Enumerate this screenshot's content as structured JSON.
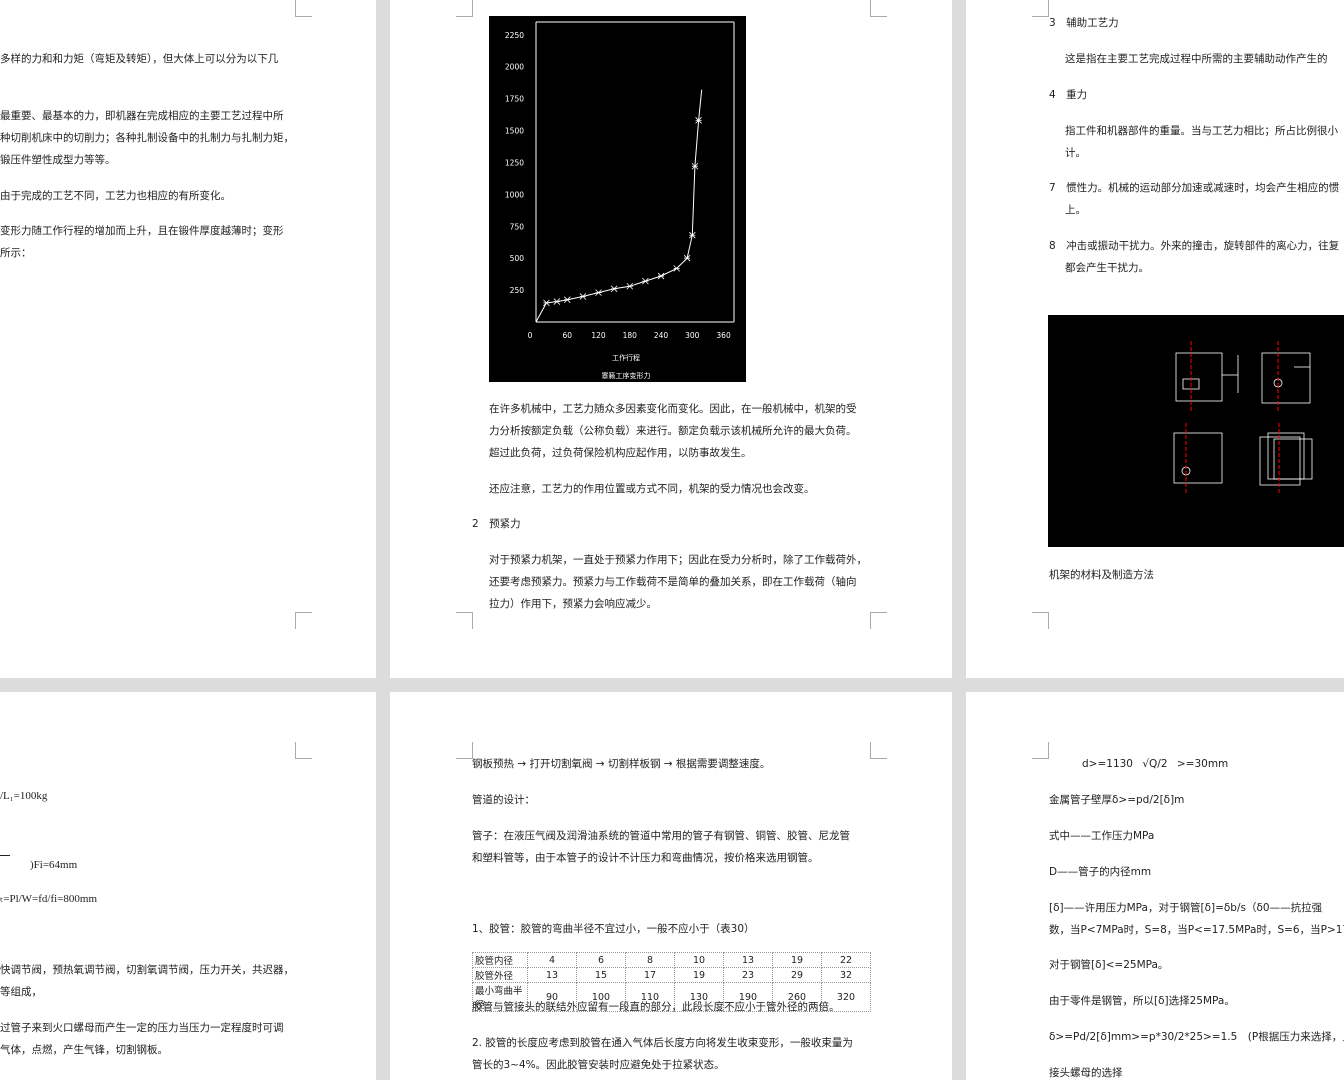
{
  "pages": {
    "p1": {
      "lines": [
        "多样的力和和力矩（弯矩及转矩），但大体上可以分为以下几",
        "最重要、最基本的力，即机器在完成相应的主要工艺过程中所",
        "种切削机床中的切削力；各种扎制设备中的扎制力与扎制力矩，",
        "锻压件塑性成型力等等。",
        "由于完成的工艺不同，工艺力也相应的有所变化。",
        "变形力随工作行程的增加而上升，且在锻件厚度越薄时；变形",
        "所示："
      ]
    },
    "p2": {
      "para1": [
        "在许多机械中，工艺力随众多因素变化而变化。因此，在一般机械中，机架的受",
        "力分析按额定负载（公称负载）来进行。额定负载示该机械所允许的最大负荷。",
        "超过此负荷，过负荷保险机构应起作用，以防事故发生。"
      ],
      "para2": "还应注意，工艺力的作用位置或方式不同，机架的受力情况也会改变。",
      "heading": "2　预紧力",
      "para3": [
        "对于预紧力机架，一直处于预紧力作用下；因此在受力分析时，除了工作载荷外，",
        "还要考虑预紧力。预紧力与工作载荷不是简单的叠加关系，即在工作载荷（轴向",
        "拉力）作用下，预紧力会响应减少。"
      ]
    },
    "p3": {
      "h3": "3　辅助工艺力",
      "t3": "这是指在主要工艺完成过程中所需的主要辅助动作产生的",
      "h4": "4　重力",
      "t4a": "指工件和机器部件的重量。当与工艺力相比；所占比例很小",
      "t4b": "计。",
      "h7a": "7　惯性力。机械的运动部分加速或减速时，均会产生相应的惯",
      "h7b": "上。",
      "h8a": "8　冲击或振动干扰力。外来的撞击，旋转部件的离心力，往复",
      "h8b": "都会产生干扰力。",
      "footer": "机架的材料及制造方法"
    },
    "p4": {
      "l1": "/L₁=100kg",
      "l2": ")Fi=64mm",
      "l3": "ₜ=Pl/W=fd/fi=800mm",
      "l4": "快调节阀，预热氧调节阀，切割氧调节阀，压力开关，共迟器，",
      "l5": "等组成，",
      "l6": "过管子来到火口螺母而产生一定的压力当压力一定程度时可调",
      "l7": "气体，点燃，产生气锋，切割钢板。"
    },
    "p5": {
      "flow": "钢板预热 → 打开切割氧阀 → 切割样板钢 → 根据需要调整速度。",
      "design": "管道的设计：",
      "pipe1": "管子：在液压气阀及润滑油系统的管道中常用的管子有钢管、铜管、胶管、尼龙管",
      "pipe2": "和塑料管等，由于本管子的设计不计压力和弯曲情况，按价格来选用钢管。",
      "hose_title": "1、胶管：胶管的弯曲半径不宜过小，一般不应小于（表30）",
      "table": {
        "rows": [
          {
            "label": "胶管内径",
            "values": [
              "4",
              "6",
              "8",
              "10",
              "13",
              "19",
              "22"
            ]
          },
          {
            "label": "胶管外径",
            "values": [
              "13",
              "15",
              "17",
              "19",
              "23",
              "29",
              "32"
            ]
          },
          {
            "label": "最小弯曲半径",
            "values": [
              "90",
              "100",
              "110",
              "130",
              "190",
              "260",
              "320"
            ]
          }
        ]
      },
      "after1": "胶管与管接头的联结外应留有一段直的部分，此段长度不应小于管外径的两倍。",
      "after2a": "2. 胶管的长度应考虑到胶管在通入气体后长度方向将发生收束变形，一般收束量为",
      "after2b": "管长的3~4%。因此胶管安装时应避免处于拉紧状态。"
    },
    "p6": {
      "eq1_left": "d>=1130",
      "eq1_rad": "√Q/2",
      "eq1_right": ">=30mm",
      "l2": "金属管子壁厚δ>=pd/2[δ]m",
      "l3": "式中——工作压力MPa",
      "l4": "D——管子的内径mm",
      "l5": "[δ]——许用压力MPa，对于钢管[δ]=δb/s（δ0——抗拉强",
      "l6": "数，当P<7MPa时，S=8，当P<=17.5MPa时，S=6，当P>17.5MPa",
      "l7": "对于钢管[δ]<=25MPa。",
      "l8": "由于零件是钢管，所以[δ]选择25MPa。",
      "l9": "δ>=Pd/2[δ]mm>=p*30/2*25>=1.5　(P根据压力来选择，见表",
      "l10": "接头螺母的选择"
    }
  },
  "chart_data": {
    "type": "line",
    "title": "",
    "caption": "寨籁工序变形力",
    "xlabel": "工作行程",
    "ylabel": "",
    "x_ticks": [
      0,
      60,
      120,
      180,
      240,
      300,
      360
    ],
    "y_ticks": [
      250,
      500,
      750,
      1000,
      1250,
      1500,
      1750,
      2000,
      2250
    ],
    "xlim": [
      0,
      380
    ],
    "ylim": [
      0,
      2350
    ],
    "series": [
      {
        "x": [
          0,
          20,
          40,
          60,
          90,
          120,
          150,
          180,
          210,
          240,
          270,
          290,
          300,
          305,
          312,
          318
        ],
        "y": [
          0,
          150,
          160,
          175,
          200,
          230,
          260,
          280,
          320,
          360,
          420,
          500,
          680,
          1220,
          1580,
          1820
        ]
      }
    ],
    "marker_x": [
      20,
      40,
      60,
      90,
      120,
      150,
      180,
      210,
      240,
      270,
      290,
      300,
      305,
      312
    ],
    "grid": false
  },
  "colors": {
    "figure_bg": "#000000",
    "line": "#ffffff",
    "red_axis": "#ff0000"
  }
}
